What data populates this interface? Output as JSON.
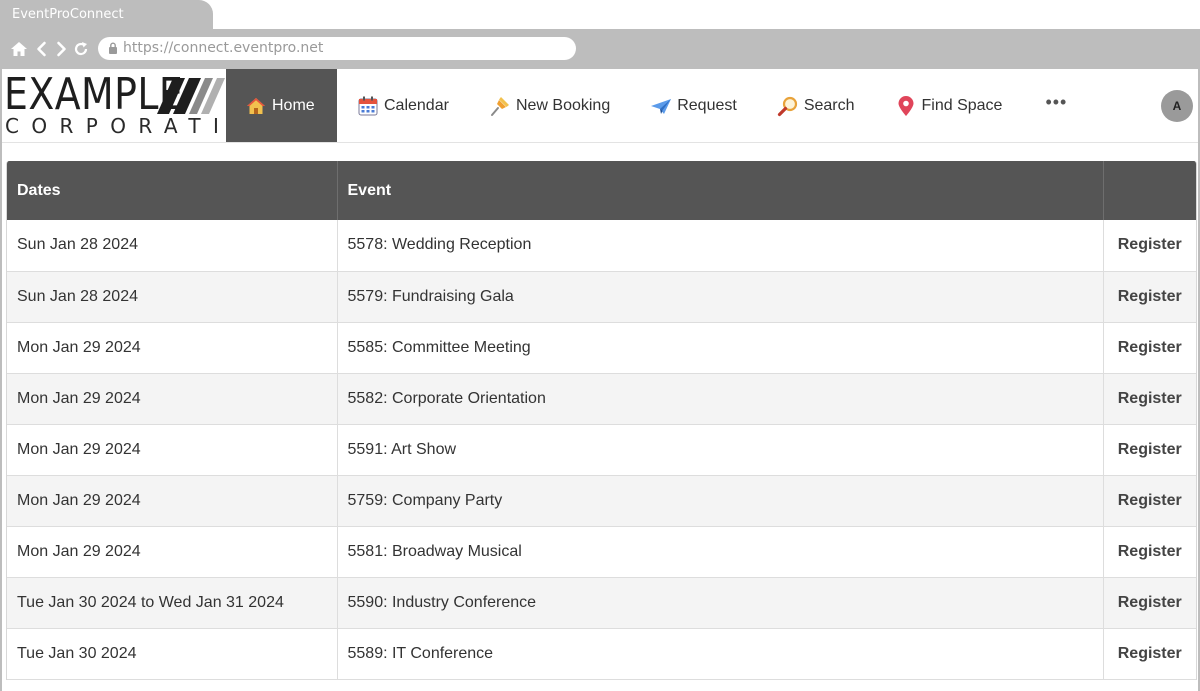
{
  "browser": {
    "tab_title": "EventProConnect",
    "url": "https://connect.eventpro.net"
  },
  "logo": {
    "line1": "EXAMPLE",
    "line2": "CORPORATION"
  },
  "nav": {
    "items": [
      {
        "label": "Home",
        "icon": "house-icon",
        "active": true
      },
      {
        "label": "Calendar",
        "icon": "calendar-icon"
      },
      {
        "label": "New Booking",
        "icon": "pushpin-icon"
      },
      {
        "label": "Request",
        "icon": "paper-plane-icon"
      },
      {
        "label": "Search",
        "icon": "magnifier-icon"
      },
      {
        "label": "Find Space",
        "icon": "map-pin-icon"
      }
    ],
    "more": "•••"
  },
  "user": {
    "avatar_initial": "A"
  },
  "table": {
    "headers": [
      "Dates",
      "Event",
      ""
    ],
    "rows": [
      {
        "date": "Sun Jan 28 2024",
        "event": "5578: Wedding Reception",
        "action": "Register"
      },
      {
        "date": "Sun Jan 28 2024",
        "event": "5579: Fundraising Gala",
        "action": "Register"
      },
      {
        "date": "Mon Jan 29 2024",
        "event": "5585: Committee Meeting",
        "action": "Register"
      },
      {
        "date": "Mon Jan 29 2024",
        "event": "5582: Corporate Orientation",
        "action": "Register"
      },
      {
        "date": "Mon Jan 29 2024",
        "event": "5591: Art Show",
        "action": "Register"
      },
      {
        "date": "Mon Jan 29 2024",
        "event": "5759: Company Party",
        "action": "Register"
      },
      {
        "date": "Mon Jan 29 2024",
        "event": "5581: Broadway Musical",
        "action": "Register"
      },
      {
        "date": "Tue Jan 30 2024 to Wed Jan 31 2024",
        "event": "5590: Industry Conference",
        "action": "Register"
      },
      {
        "date": "Tue Jan 30 2024",
        "event": "5589: IT Conference",
        "action": "Register"
      }
    ]
  },
  "colors": {
    "chrome": "#bdbdbd",
    "header_bg": "#555555",
    "row_alt": "#f4f4f4",
    "avatar_bg": "#9a9a9a"
  }
}
